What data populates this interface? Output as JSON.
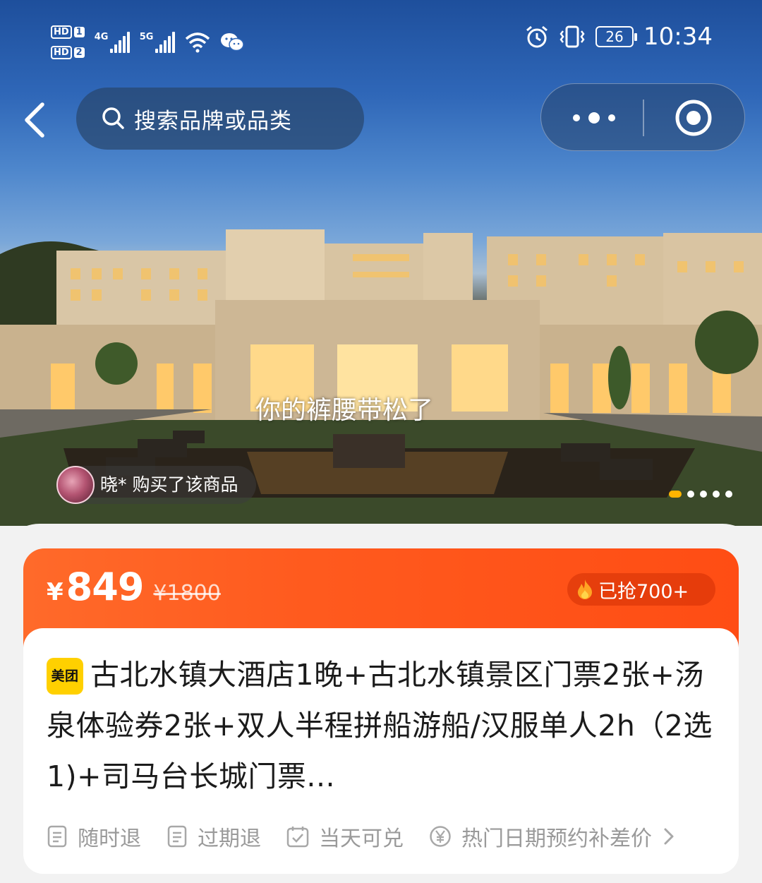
{
  "status_bar": {
    "sim1": "HD",
    "sim1_num": "1",
    "sim2": "HD",
    "sim2_num": "2",
    "net1": "4G",
    "net2": "5G",
    "battery": "26",
    "time": "10:34"
  },
  "nav": {
    "search_placeholder": "搜索品牌或品类"
  },
  "hero": {
    "danmu": "你的裤腰带松了",
    "buyer_notice": "晓* 购买了该商品",
    "pager_count": 5,
    "pager_active": 0
  },
  "price": {
    "currency": "¥",
    "amount": "849",
    "original": "¥1800",
    "sold": "已抢700+"
  },
  "product": {
    "brand_label": "美团",
    "title": "古北水镇大酒店1晚+古北水镇景区门票2张+汤泉体验券2张+双人半程拼船游船/汉服单人2h（2选1)+司马台长城门票..."
  },
  "tags": [
    {
      "icon": "document-icon",
      "label": "随时退"
    },
    {
      "icon": "document-icon",
      "label": "过期退"
    },
    {
      "icon": "calendar-check-icon",
      "label": "当天可兑"
    },
    {
      "icon": "yen-circle-icon",
      "label": "热门日期预约补差价"
    }
  ],
  "colors": {
    "accent": "#ff5a1e",
    "brand_yellow": "#ffd000",
    "pager_active": "#ffb400"
  }
}
